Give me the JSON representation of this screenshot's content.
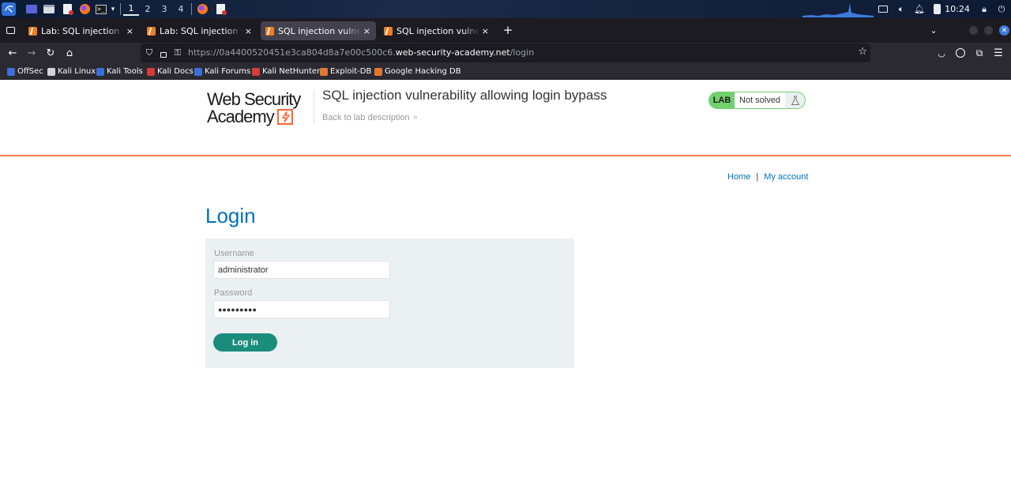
{
  "panel": {
    "workspaces": [
      "1",
      "2",
      "3",
      "4"
    ],
    "active_workspace": "1",
    "clock": "10:24",
    "icons": [
      "kali-menu-icon",
      "desktop-icon",
      "file-manager-icon",
      "text-editor-icon",
      "firefox-icon",
      "terminal-icon",
      "dropdown-icon",
      "firefox-icon",
      "burp-icon",
      "display-icon",
      "volume-icon",
      "notifications-icon",
      "battery-icon",
      "lock-icon",
      "power-icon"
    ]
  },
  "browser": {
    "tabs": [
      {
        "label": "Lab: SQL injection vulnera",
        "active": false
      },
      {
        "label": "Lab: SQL injection vulnera",
        "active": false
      },
      {
        "label": "SQL injection vulnerability",
        "active": true
      },
      {
        "label": "SQL injection vulnerability",
        "active": false
      }
    ],
    "close_glyph": "×",
    "new_tab_glyph": "+",
    "url_prefix": "https://0a4400520451e3ca804d8a7e00c500c6.",
    "url_domain": "web-security-academy.net",
    "url_path": "/login",
    "bookmarks": [
      {
        "label": "OffSec",
        "color": "#3b6fd9"
      },
      {
        "label": "Kali Linux",
        "color": "#cfd3da"
      },
      {
        "label": "Kali Tools",
        "color": "#3b6fd9"
      },
      {
        "label": "Kali Docs",
        "color": "#d93b3b"
      },
      {
        "label": "Kali Forums",
        "color": "#3b6fd9"
      },
      {
        "label": "Kali NetHunter",
        "color": "#d93b3b"
      },
      {
        "label": "Exploit-DB",
        "color": "#e0782f"
      },
      {
        "label": "Google Hacking DB",
        "color": "#e0782f"
      }
    ]
  },
  "page": {
    "logo_line1": "Web Security",
    "logo_line2": "Academy",
    "lab_title": "SQL injection vulnerability allowing login bypass",
    "back_link": "Back to lab description",
    "back_chevron": "»",
    "lab_badge": "LAB",
    "lab_status": "Not solved",
    "nav_home": "Home",
    "nav_separator": "|",
    "nav_account": "My account",
    "heading": "Login",
    "username_label": "Username",
    "username_value": "administrator",
    "password_label": "Password",
    "password_value": "●●●●●●●●●",
    "login_button": "Log in"
  },
  "colors": {
    "accent_orange": "#ff6633",
    "link_blue": "#0071bc",
    "button_green": "#1a8c7b",
    "lab_green": "#70d16d"
  }
}
